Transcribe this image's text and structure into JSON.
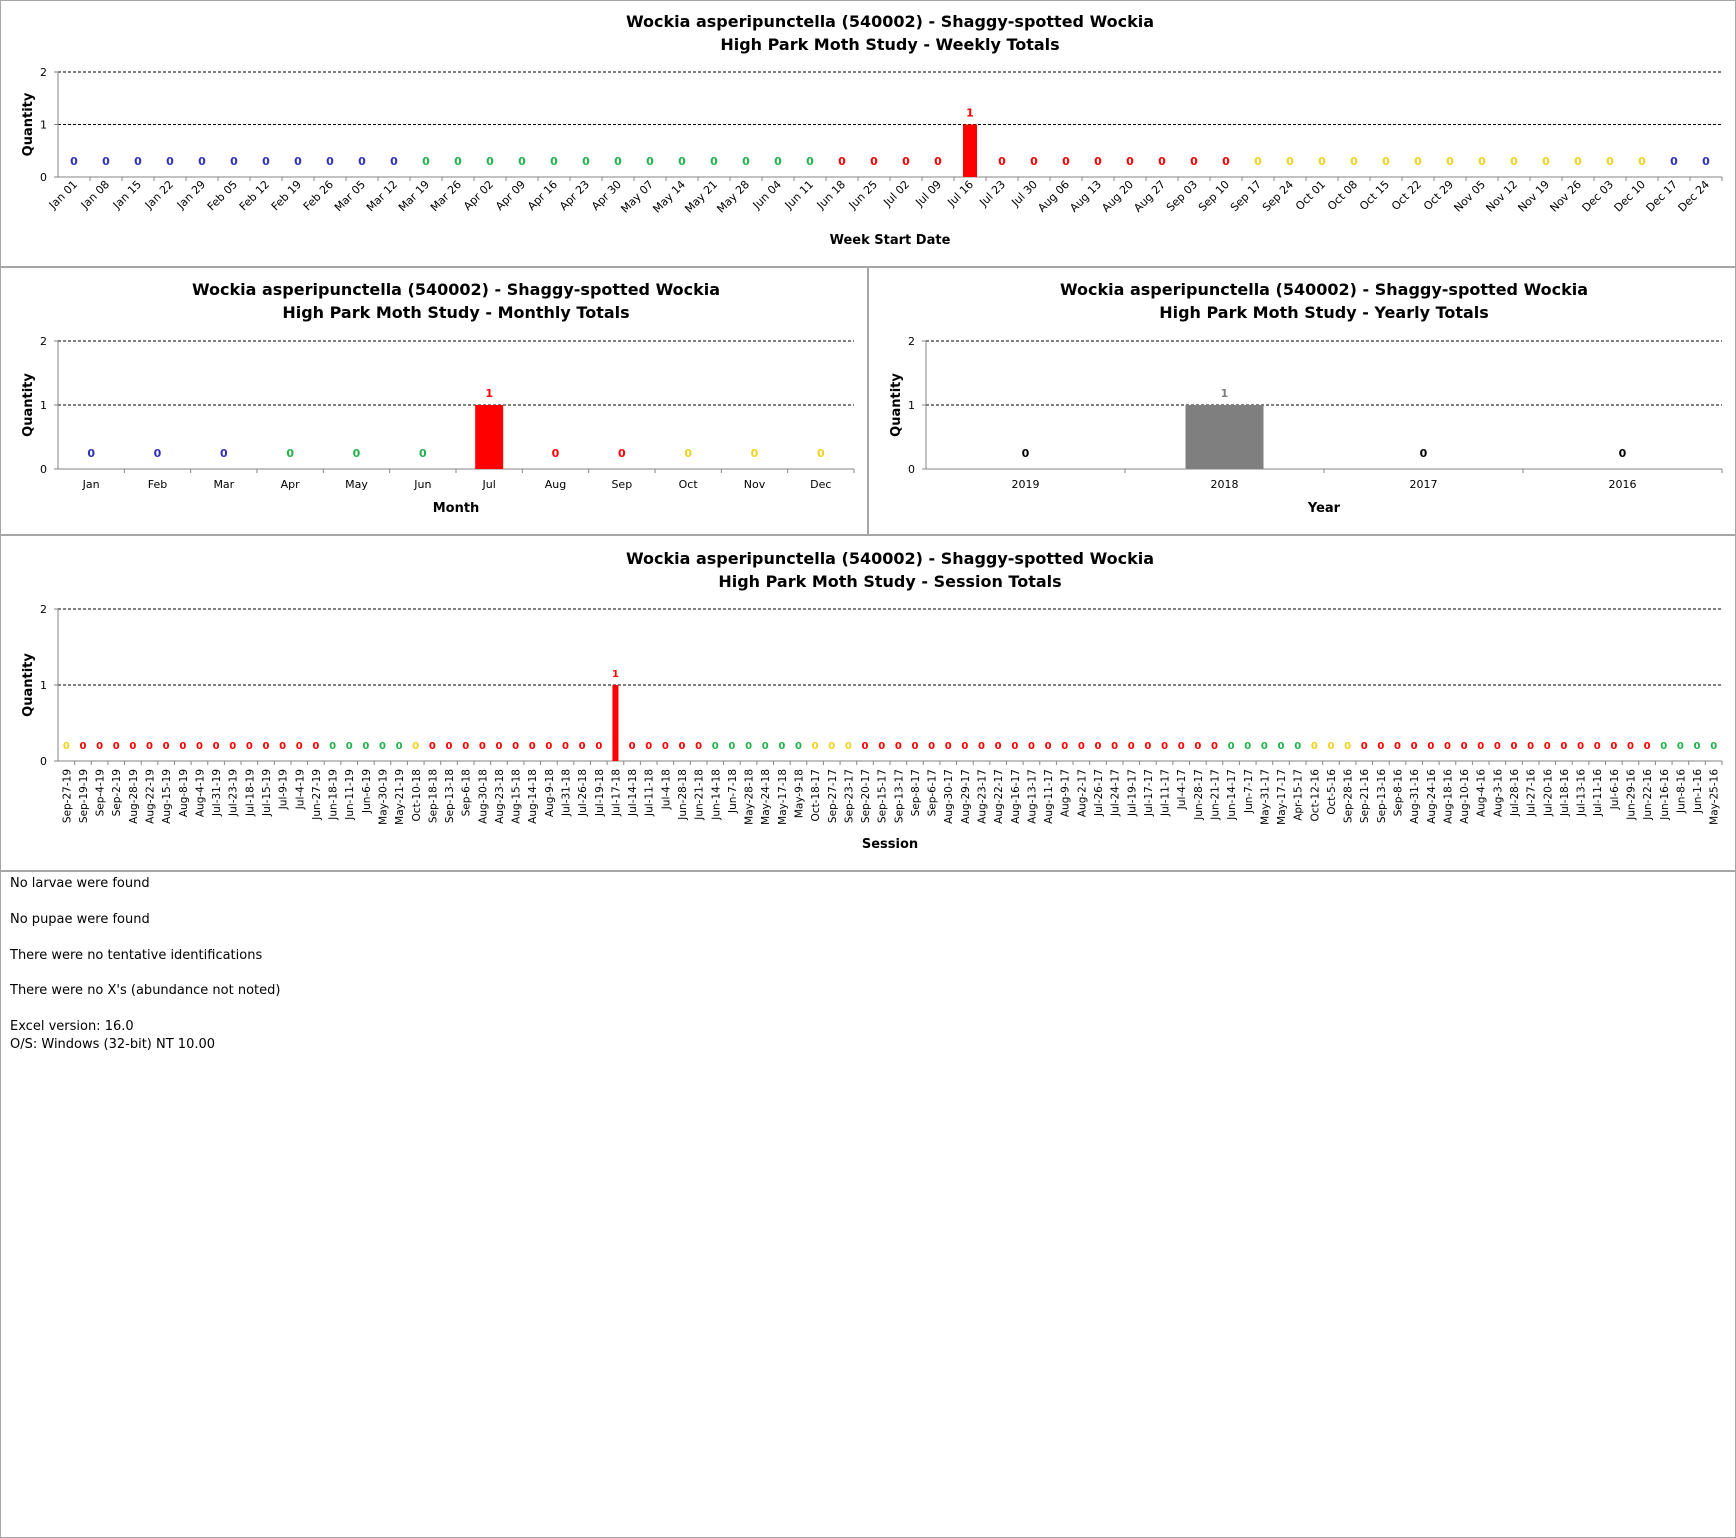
{
  "colors": {
    "blue": "#2e2eb8",
    "green": "#22b14c",
    "red": "#ff0000",
    "yellow": "#f2d21e",
    "grey": "#7f7f7f",
    "black": "#000000"
  },
  "chart_data": [
    {
      "id": "weekly",
      "type": "bar",
      "title": "Wockia asperipunctella (540002)  - Shaggy-spotted Wockia",
      "subtitle": "High Park Moth Study  -  Weekly Totals",
      "xlabel": "Week Start Date",
      "ylabel": "Quantity",
      "ylim": [
        0,
        2
      ],
      "yticks": [
        0,
        1,
        2
      ],
      "grid": "dashed-horizontal",
      "rotate_labels": true,
      "categories": [
        "Jan 01",
        "Jan 08",
        "Jan 15",
        "Jan 22",
        "Jan 29",
        "Feb 05",
        "Feb 12",
        "Feb 19",
        "Feb 26",
        "Mar 05",
        "Mar 12",
        "Mar 19",
        "Mar 26",
        "Apr 02",
        "Apr 09",
        "Apr 16",
        "Apr 23",
        "Apr 30",
        "May 07",
        "May 14",
        "May 21",
        "May 28",
        "Jun 04",
        "Jun 11",
        "Jun 18",
        "Jun 25",
        "Jul 02",
        "Jul 09",
        "Jul 16",
        "Jul 23",
        "Jul 30",
        "Aug 06",
        "Aug 13",
        "Aug 20",
        "Aug 27",
        "Sep 03",
        "Sep 10",
        "Sep 17",
        "Sep 24",
        "Oct 01",
        "Oct 08",
        "Oct 15",
        "Oct 22",
        "Oct 29",
        "Nov 05",
        "Nov 12",
        "Nov 19",
        "Nov 26",
        "Dec 03",
        "Dec 10",
        "Dec 17",
        "Dec 24"
      ],
      "values": [
        0,
        0,
        0,
        0,
        0,
        0,
        0,
        0,
        0,
        0,
        0,
        0,
        0,
        0,
        0,
        0,
        0,
        0,
        0,
        0,
        0,
        0,
        0,
        0,
        0,
        0,
        0,
        0,
        1,
        0,
        0,
        0,
        0,
        0,
        0,
        0,
        0,
        0,
        0,
        0,
        0,
        0,
        0,
        0,
        0,
        0,
        0,
        0,
        0,
        0,
        0,
        0
      ],
      "colors": [
        "blue",
        "blue",
        "blue",
        "blue",
        "blue",
        "blue",
        "blue",
        "blue",
        "blue",
        "blue",
        "blue",
        "green",
        "green",
        "green",
        "green",
        "green",
        "green",
        "green",
        "green",
        "green",
        "green",
        "green",
        "green",
        "green",
        "red",
        "red",
        "red",
        "red",
        "red",
        "red",
        "red",
        "red",
        "red",
        "red",
        "red",
        "red",
        "red",
        "yellow",
        "yellow",
        "yellow",
        "yellow",
        "yellow",
        "yellow",
        "yellow",
        "yellow",
        "yellow",
        "yellow",
        "yellow",
        "yellow",
        "yellow",
        "blue",
        "blue"
      ]
    },
    {
      "id": "monthly",
      "type": "bar",
      "title": "Wockia asperipunctella (540002)  - Shaggy-spotted Wockia",
      "subtitle": "High Park Moth Study  -  Monthly Totals",
      "xlabel": "Month",
      "ylabel": "Quantity",
      "ylim": [
        0,
        2
      ],
      "yticks": [
        0,
        1,
        2
      ],
      "grid": "dashed-horizontal",
      "rotate_labels": false,
      "categories": [
        "Jan",
        "Feb",
        "Mar",
        "Apr",
        "May",
        "Jun",
        "Jul",
        "Aug",
        "Sep",
        "Oct",
        "Nov",
        "Dec"
      ],
      "values": [
        0,
        0,
        0,
        0,
        0,
        0,
        1,
        0,
        0,
        0,
        0,
        0
      ],
      "colors": [
        "blue",
        "blue",
        "blue",
        "green",
        "green",
        "green",
        "red",
        "red",
        "red",
        "yellow",
        "yellow",
        "yellow"
      ]
    },
    {
      "id": "yearly",
      "type": "bar",
      "title": "Wockia asperipunctella (540002)  - Shaggy-spotted Wockia",
      "subtitle": "High Park Moth Study  -  Yearly Totals",
      "xlabel": "Year",
      "ylabel": "Quantity",
      "ylim": [
        0,
        2
      ],
      "yticks": [
        0,
        1,
        2
      ],
      "grid": "dashed-horizontal",
      "rotate_labels": false,
      "categories": [
        "2019",
        "2018",
        "2017",
        "2016"
      ],
      "values": [
        0,
        1,
        0,
        0
      ],
      "colors": [
        "black",
        "grey",
        "black",
        "black"
      ]
    },
    {
      "id": "session",
      "type": "bar",
      "title": "Wockia asperipunctella (540002)  - Shaggy-spotted Wockia",
      "subtitle": "High Park Moth Study  -  Session Totals",
      "xlabel": "Session",
      "ylabel": "Quantity",
      "ylim": [
        0,
        2
      ],
      "yticks": [
        0,
        1,
        2
      ],
      "grid": "dashed-horizontal",
      "rotate_labels": true,
      "categories": [
        "Sep-27-19",
        "Sep-19-19",
        "Sep-4-19",
        "Sep-2-19",
        "Aug-28-19",
        "Aug-22-19",
        "Aug-15-19",
        "Aug-8-19",
        "Aug-4-19",
        "Jul-31-19",
        "Jul-23-19",
        "Jul-18-19",
        "Jul-15-19",
        "Jul-9-19",
        "Jul-4-19",
        "Jun-27-19",
        "Jun-18-19",
        "Jun-11-19",
        "Jun-6-19",
        "May-30-19",
        "May-21-19",
        "Oct-10-18",
        "Sep-18-18",
        "Sep-13-18",
        "Sep-6-18",
        "Aug-30-18",
        "Aug-23-18",
        "Aug-15-18",
        "Aug-14-18",
        "Aug-9-18",
        "Jul-31-18",
        "Jul-26-18",
        "Jul-19-18",
        "Jul-17-18",
        "Jul-14-18",
        "Jul-11-18",
        "Jul-4-18",
        "Jun-28-18",
        "Jun-21-18",
        "Jun-14-18",
        "Jun-7-18",
        "May-28-18",
        "May-24-18",
        "May-17-18",
        "May-9-18",
        "Oct-18-17",
        "Sep-27-17",
        "Sep-23-17",
        "Sep-20-17",
        "Sep-15-17",
        "Sep-13-17",
        "Sep-8-17",
        "Sep-6-17",
        "Aug-30-17",
        "Aug-29-17",
        "Aug-23-17",
        "Aug-22-17",
        "Aug-16-17",
        "Aug-13-17",
        "Aug-11-17",
        "Aug-9-17",
        "Aug-2-17",
        "Jul-26-17",
        "Jul-24-17",
        "Jul-19-17",
        "Jul-17-17",
        "Jul-11-17",
        "Jul-4-17",
        "Jun-28-17",
        "Jun-21-17",
        "Jun-14-17",
        "Jun-7-17",
        "May-31-17",
        "May-17-17",
        "Apr-15-17",
        "Oct-12-16",
        "Oct-5-16",
        "Sep-28-16",
        "Sep-21-16",
        "Sep-13-16",
        "Sep-8-16",
        "Aug-31-16",
        "Aug-24-16",
        "Aug-18-16",
        "Aug-10-16",
        "Aug-4-16",
        "Aug-3-16",
        "Jul-28-16",
        "Jul-27-16",
        "Jul-20-16",
        "Jul-18-16",
        "Jul-13-16",
        "Jul-11-16",
        "Jul-6-16",
        "Jun-29-16",
        "Jun-22-16",
        "Jun-16-16",
        "Jun-8-16",
        "Jun-1-16",
        "May-25-16"
      ],
      "values": [
        0,
        0,
        0,
        0,
        0,
        0,
        0,
        0,
        0,
        0,
        0,
        0,
        0,
        0,
        0,
        0,
        0,
        0,
        0,
        0,
        0,
        0,
        0,
        0,
        0,
        0,
        0,
        0,
        0,
        0,
        0,
        0,
        0,
        1,
        0,
        0,
        0,
        0,
        0,
        0,
        0,
        0,
        0,
        0,
        0,
        0,
        0,
        0,
        0,
        0,
        0,
        0,
        0,
        0,
        0,
        0,
        0,
        0,
        0,
        0,
        0,
        0,
        0,
        0,
        0,
        0,
        0,
        0,
        0,
        0,
        0,
        0,
        0,
        0,
        0,
        0,
        0,
        0,
        0,
        0,
        0,
        0,
        0,
        0,
        0,
        0,
        0,
        0,
        0,
        0,
        0,
        0,
        0,
        0,
        0,
        0,
        0,
        0,
        0,
        0
      ],
      "colors": [
        "yellow",
        "red",
        "red",
        "red",
        "red",
        "red",
        "red",
        "red",
        "red",
        "red",
        "red",
        "red",
        "red",
        "red",
        "red",
        "red",
        "green",
        "green",
        "green",
        "green",
        "green",
        "yellow",
        "red",
        "red",
        "red",
        "red",
        "red",
        "red",
        "red",
        "red",
        "red",
        "red",
        "red",
        "red",
        "red",
        "red",
        "red",
        "red",
        "red",
        "green",
        "green",
        "green",
        "green",
        "green",
        "green",
        "yellow",
        "yellow",
        "yellow",
        "red",
        "red",
        "red",
        "red",
        "red",
        "red",
        "red",
        "red",
        "red",
        "red",
        "red",
        "red",
        "red",
        "red",
        "red",
        "red",
        "red",
        "red",
        "red",
        "red",
        "red",
        "red",
        "green",
        "green",
        "green",
        "green",
        "green",
        "yellow",
        "yellow",
        "yellow",
        "red",
        "red",
        "red",
        "red",
        "red",
        "red",
        "red",
        "red",
        "red",
        "red",
        "red",
        "red",
        "red",
        "red",
        "red",
        "red",
        "red",
        "red",
        "green",
        "green",
        "green",
        "green"
      ]
    }
  ],
  "notes": {
    "larvae": "No larvae were found",
    "pupae": "No pupae were found",
    "tentative": "There were no tentative identifications",
    "xs": "There were no X's (abundance not noted)",
    "excel": "Excel version: 16.0",
    "os": "O/S: Windows (32-bit) NT 10.00"
  }
}
